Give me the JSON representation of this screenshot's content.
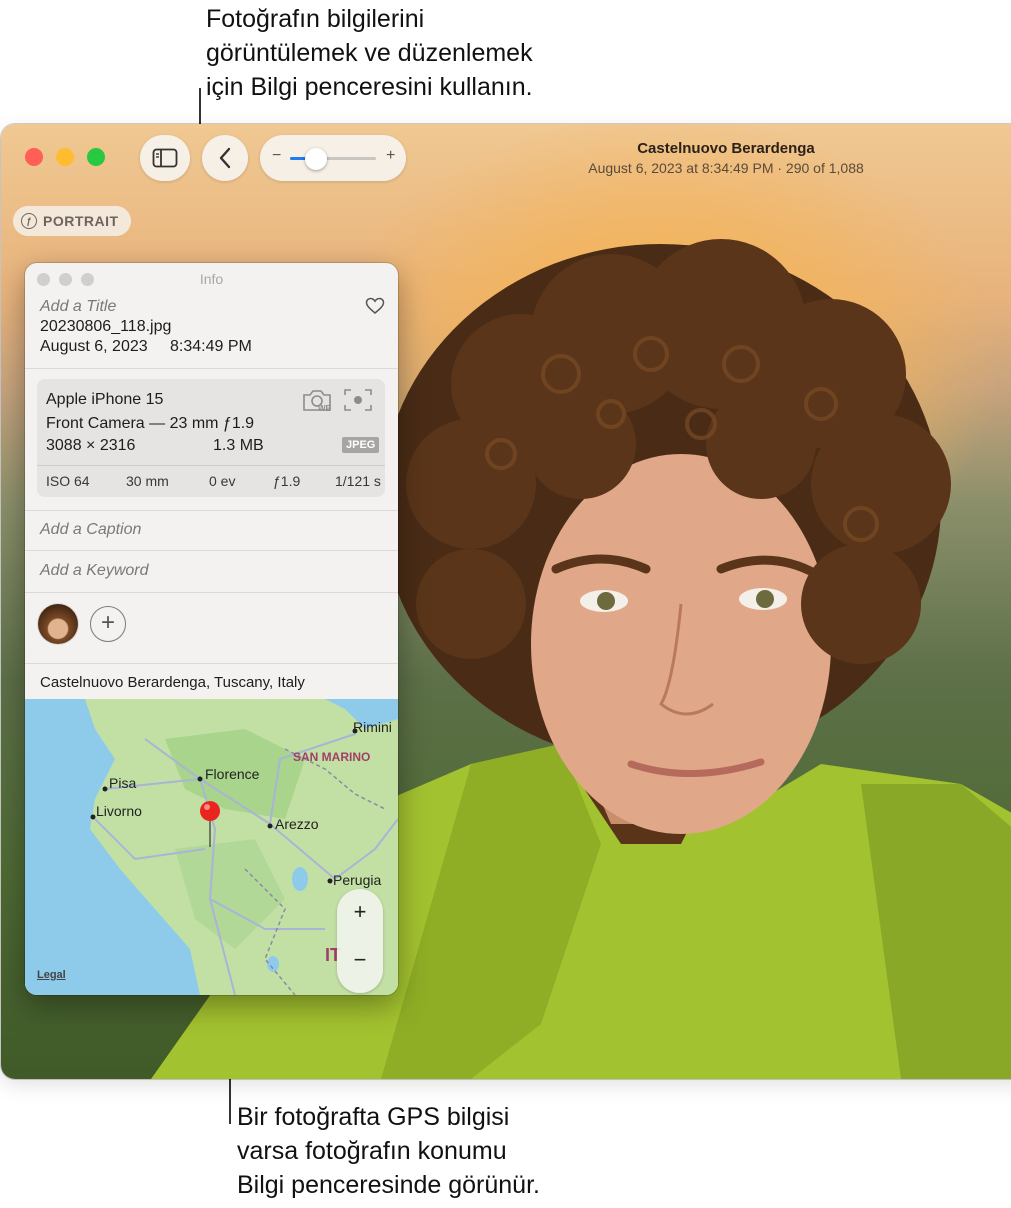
{
  "callouts": {
    "top": "Fotoğrafın bilgilerini\ngörüntülemek ve düzenlemek\niçin Bilgi penceresini kullanın.",
    "bottom": "Bir fotoğrafta GPS bilgisi\nvarsa fotoğrafın konumu\nBilgi penceresinde görünür."
  },
  "window": {
    "title": "Castelnuovo Berardenga",
    "subtitle": "August 6, 2023 at 8:34:49 PM  ·  290 of 1,088",
    "portrait_badge": "PORTRAIT",
    "zoom_minus": "−",
    "zoom_plus": "+",
    "zoom_level": 0.3
  },
  "info": {
    "title": "Info",
    "add_title": "Add a Title",
    "filename": "20230806_118.jpg",
    "date": "August 6, 2023",
    "time": "8:34:49 PM",
    "camera": {
      "model": "Apple iPhone 15",
      "lens": "Front Camera — 23 mm ƒ1.9",
      "resolution": "3088 × 2316",
      "size": "1.3 MB",
      "format": "JPEG",
      "exif": [
        "ISO 64",
        "30 mm",
        "0 ev",
        "ƒ1.9",
        "1/121 s"
      ]
    },
    "caption_placeholder": "Add a Caption",
    "keyword_placeholder": "Add a Keyword",
    "add_person": "+",
    "location": "Castelnuovo Berardenga, Tuscany, Italy",
    "map": {
      "labels": [
        "Rimini",
        "SAN MARINO",
        "Pisa",
        "Florence",
        "Livorno",
        "Arezzo",
        "Perugia",
        "IT"
      ],
      "zoom_in": "+",
      "zoom_out": "−",
      "legal": "Legal"
    }
  },
  "colors": {
    "close": "#ff5f57",
    "minimize": "#febc2e",
    "zoom": "#28c840",
    "accent": "#1e7cf5",
    "pin": "#e8251f"
  }
}
